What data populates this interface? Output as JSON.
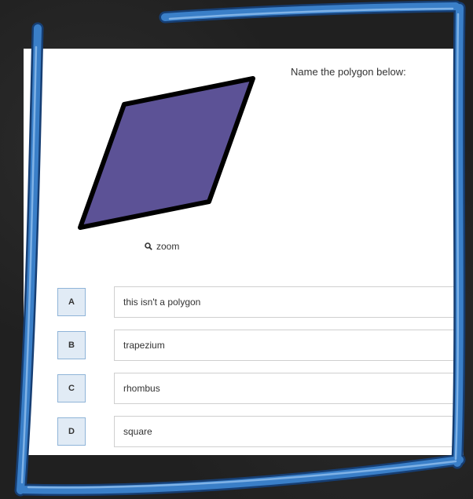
{
  "question": {
    "text": "Name the polygon below:"
  },
  "figure": {
    "shape": "parallelogram",
    "fill_color": "#5c5296",
    "stroke_color": "#000000"
  },
  "zoom": {
    "label": "zoom",
    "icon": "search-icon"
  },
  "options": [
    {
      "letter": "A",
      "text": "this isn't a polygon"
    },
    {
      "letter": "B",
      "text": "trapezium"
    },
    {
      "letter": "C",
      "text": "rhombus"
    },
    {
      "letter": "D",
      "text": "square"
    }
  ],
  "colors": {
    "frame": "#3a7fc8",
    "background": "#232323",
    "option_letter_bg": "#e1ebf5"
  }
}
